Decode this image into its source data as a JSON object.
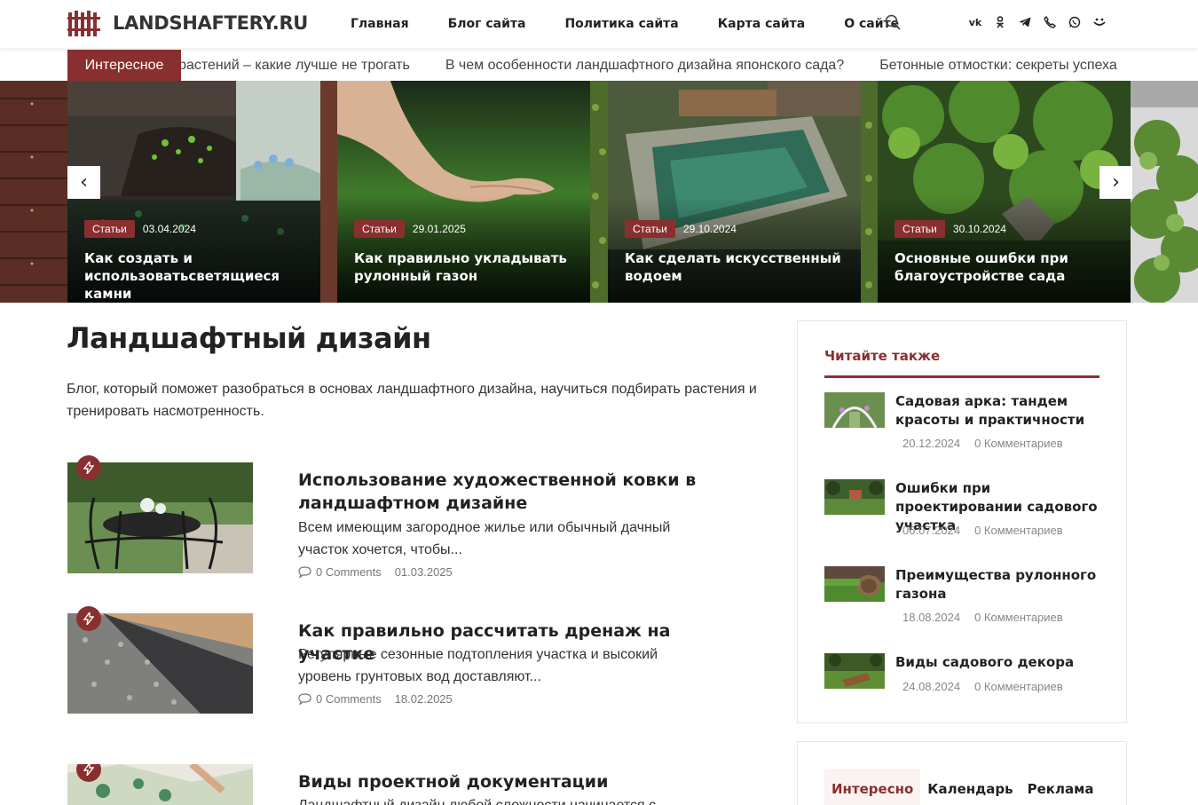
{
  "header": {
    "logo_text": "LANDSHAFTERY.RU",
    "nav": [
      "Главная",
      "Блог сайта",
      "Политика сайта",
      "Карта сайта",
      "О сайте"
    ],
    "socials": [
      "vk-icon",
      "odnoklassniki-icon",
      "telegram-icon",
      "viber-icon",
      "whatsapp-icon",
      "moy-mir-icon"
    ]
  },
  "ticker": {
    "label": "Интересное",
    "items": [
      "Обрезка растений – какие лучше не трогать",
      "В чем особенности ландшафтного дизайна японского сада?",
      "Бетонные отмостки: секреты успеха"
    ]
  },
  "slider": {
    "slides": [
      {
        "category": "Статьи",
        "date": "03.04.2024",
        "title": "Как создать и использоватьсветящиеся камни"
      },
      {
        "category": "Статьи",
        "date": "29.01.2025",
        "title": "Как правильно укладывать рулонный газон"
      },
      {
        "category": "Статьи",
        "date": "29.10.2024",
        "title": "Как сделать искусственный водоем"
      },
      {
        "category": "Статьи",
        "date": "30.10.2024",
        "title": "Основные ошибки при благоустройстве сада"
      }
    ],
    "prev_label": "‹",
    "next_label": "›"
  },
  "main": {
    "title": "Ландшафтный дизайн",
    "description": "Блог, который поможет разобраться в основах ландшафтного дизайна, научиться подбирать растения и тренировать насмотренность.",
    "posts": [
      {
        "title": "Использование художественной ковки в ландшафтном дизайне",
        "excerpt": "Всем имеющим загородное жилье или обычный дачный участок хочется, чтобы...",
        "comments": "0 Comments",
        "date": "01.03.2025"
      },
      {
        "title": "Как правильно рассчитать дренаж на участке",
        "excerpt": "Регулярные сезонные подтопления участка и высокий уровень грунтовых вод доставляют...",
        "comments": "0 Comments",
        "date": "18.02.2025"
      },
      {
        "title": "Виды проектной документации",
        "excerpt": "Ландшафтный дизайн любой сложности начинается с"
      }
    ]
  },
  "sidebar": {
    "related_title": "Читайте также",
    "related": [
      {
        "title": "Садовая арка: тандем красоты и практичности",
        "date": "20.12.2024",
        "comments": "0 Комментариев"
      },
      {
        "title": "Ошибки при проектировании садового участка",
        "date": "06.07.2024",
        "comments": "0 Комментариев"
      },
      {
        "title": "Преимущества рулонного газона",
        "date": "18.08.2024",
        "comments": "0 Комментариев"
      },
      {
        "title": "Виды садового декора",
        "date": "24.08.2024",
        "comments": "0 Комментариев"
      }
    ],
    "tabs": [
      "Интересно",
      "Календарь",
      "Реклама"
    ]
  },
  "colors": {
    "accent": "#8a2f2f",
    "ticker_label_bg": "#8a2f2f",
    "text": "#222222"
  }
}
